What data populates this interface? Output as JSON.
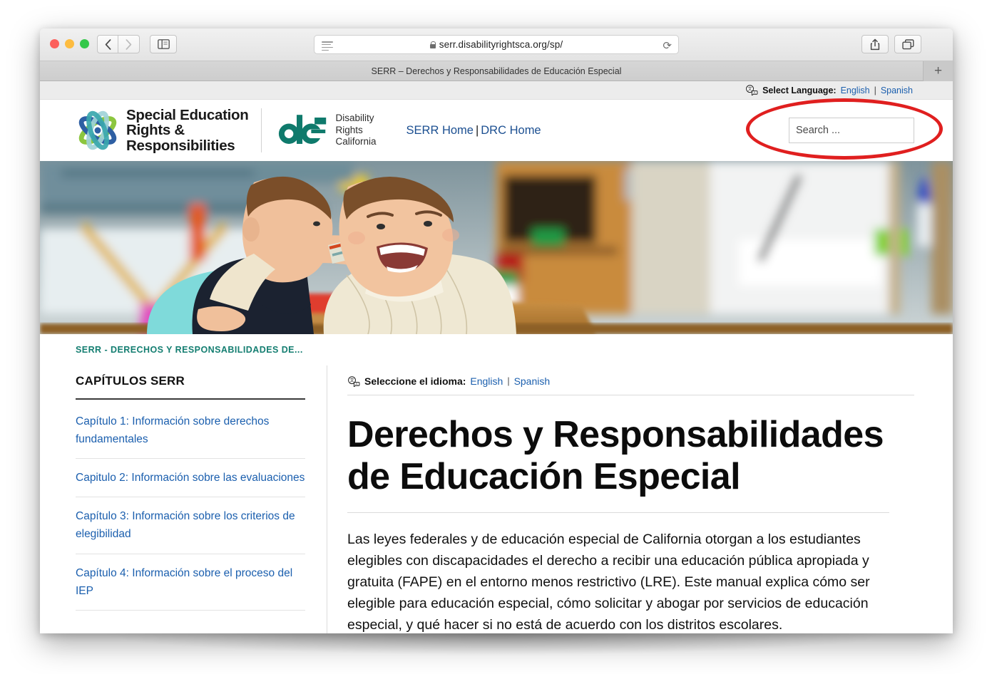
{
  "browser": {
    "url": "serr.disabilityrightsca.org/sp/",
    "tab_title": "SERR – Derechos y Responsabilidades de Educación Especial",
    "back_label": "‹",
    "forward_label": "›",
    "reload_label": "⟳",
    "new_tab_label": "+"
  },
  "topbar": {
    "select_language_label": "Select Language:",
    "english": "English",
    "separator": "|",
    "spanish": "Spanish"
  },
  "header": {
    "serr_logo_line1": "Special Education",
    "serr_logo_line2": "Rights &",
    "serr_logo_line3": "Responsibilities",
    "drc_line1": "Disability",
    "drc_line2": "Rights",
    "drc_line3": "California",
    "nav_serr_home": "SERR Home",
    "nav_separator": "|",
    "nav_drc_home": "DRC Home",
    "search_placeholder": "Search ...",
    "search_value": ""
  },
  "breadcrumb": {
    "text": "SERR - DERECHOS Y RESPONSABILIDADES DE..."
  },
  "sidebar": {
    "title": "CAPÍTULOS SERR",
    "chapters": [
      "Capítulo 1: Información sobre derechos fundamentales",
      "Capitulo 2: Información sobre las evaluaciones",
      "Capítulo 3: Información sobre los criterios de elegibilidad",
      "Capítulo 4: Información sobre el proceso del IEP"
    ]
  },
  "main": {
    "language_label": "Seleccione el idioma:",
    "english": "English",
    "separator": "|",
    "spanish": "Spanish",
    "title": "Derechos y Responsabilidades de Educación Especial",
    "paragraph": "Las leyes federales y de educación especial de California otorgan a los estudiantes elegibles con discapacidades el derecho a recibir una educación pública apropiada y gratuita (FAPE) en el entorno menos restrictivo (LRE). Este manual explica cómo ser elegible para educación especial, cómo solicitar y abogar por servicios de educación especial, y qué hacer si no está de acuerdo con los distritos escolares."
  },
  "colors": {
    "link_blue": "#1b5fae",
    "breadcrumb_teal": "#147e71",
    "drc_teal": "#0f7a6c",
    "annotation_red": "#e01f1f"
  }
}
